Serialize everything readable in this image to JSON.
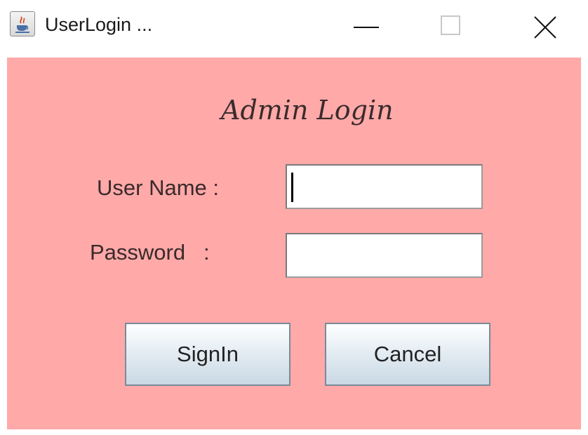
{
  "window": {
    "title": "UserLogin ..."
  },
  "form": {
    "heading": "Admin Login",
    "username_label": "User Name :",
    "username_value": "",
    "password_label": "Password   :",
    "password_value": ""
  },
  "buttons": {
    "signin_label": "SignIn",
    "cancel_label": "Cancel"
  },
  "colors": {
    "panel_background": "#ffa9a9",
    "button_gradient_bottom": "#c9d8e4"
  },
  "icons": {
    "app": "java-coffee-cup-icon",
    "minimize": "minimize-icon",
    "maximize": "maximize-icon",
    "close": "close-icon"
  }
}
